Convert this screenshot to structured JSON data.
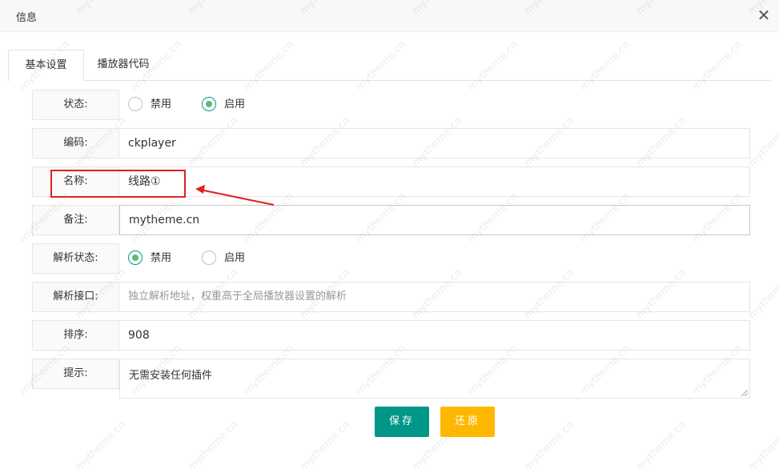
{
  "dialog": {
    "title": "信息"
  },
  "tabs": [
    {
      "label": "基本设置",
      "active": true
    },
    {
      "label": "播放器代码",
      "active": false
    }
  ],
  "form": {
    "status": {
      "label": "状态:",
      "options": [
        "禁用",
        "启用"
      ],
      "selected": "启用"
    },
    "code": {
      "label": "编码:",
      "value": "ckplayer"
    },
    "name": {
      "label": "名称:",
      "value": "线路①"
    },
    "note": {
      "label": "备注:",
      "value": "mytheme.cn"
    },
    "parse_status": {
      "label": "解析状态:",
      "options": [
        "禁用",
        "启用"
      ],
      "selected": "禁用"
    },
    "parse_api": {
      "label": "解析接口:",
      "placeholder": "独立解析地址，权重高于全局播放器设置的解析"
    },
    "sort": {
      "label": "排序:",
      "value": "908"
    },
    "tip": {
      "label": "提示:",
      "value": "无需安装任何插件"
    }
  },
  "buttons": {
    "save": "保存",
    "reset": "还原"
  },
  "annotation": {
    "color": "#e02020"
  },
  "watermark": {
    "text": "mytheme.cn"
  },
  "colors": {
    "primary": "#009688",
    "warm": "#FFB800",
    "radio_dot": "#5FB878"
  }
}
